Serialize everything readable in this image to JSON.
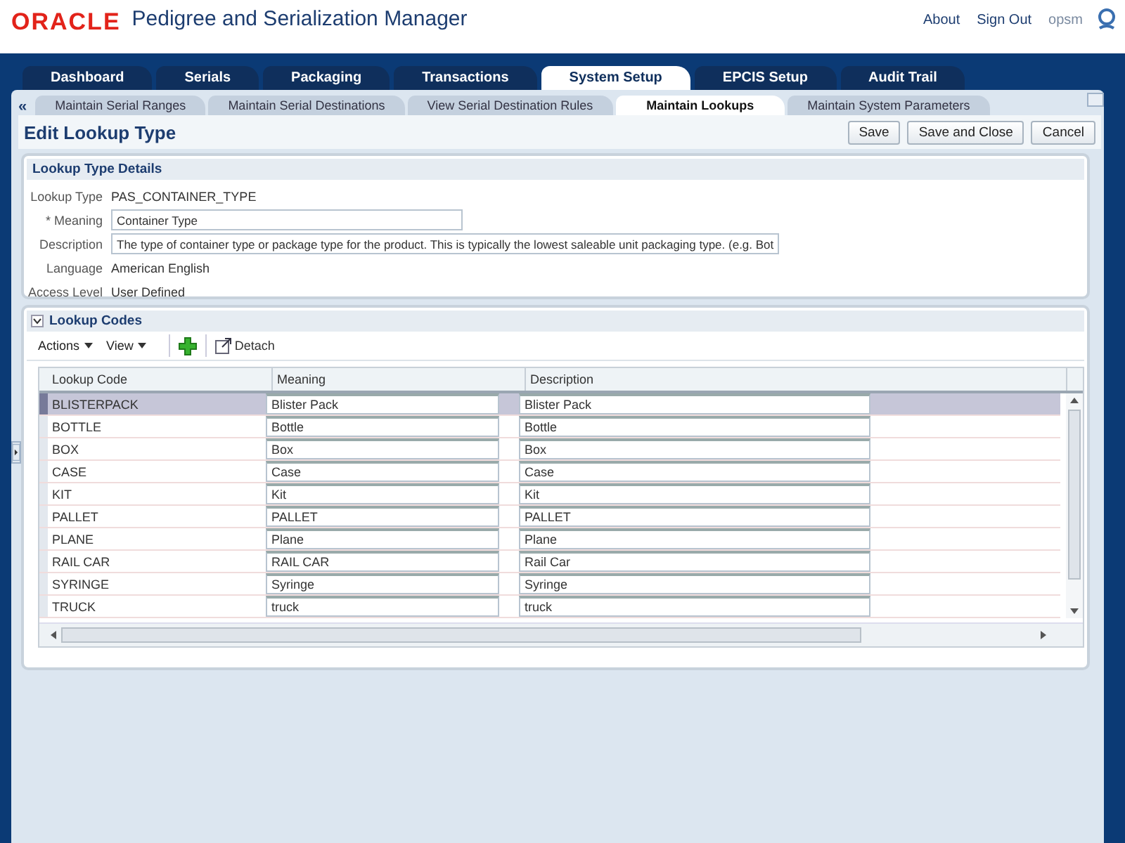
{
  "header": {
    "logo": "ORACLE",
    "title": "Pedigree and Serialization Manager",
    "links": [
      "About",
      "Sign Out"
    ],
    "user": "opsm"
  },
  "tabs": [
    {
      "label": "Dashboard",
      "selected": false
    },
    {
      "label": "Serials",
      "selected": false
    },
    {
      "label": "Packaging",
      "selected": false
    },
    {
      "label": "Transactions",
      "selected": false
    },
    {
      "label": "System Setup",
      "selected": true
    },
    {
      "label": "EPCIS Setup",
      "selected": false
    },
    {
      "label": "Audit Trail",
      "selected": false
    }
  ],
  "subtabs": {
    "scroll": "«",
    "items": [
      {
        "label": "Maintain Serial Ranges",
        "selected": false
      },
      {
        "label": "Maintain Serial Destinations",
        "selected": false
      },
      {
        "label": "View Serial Destination Rules",
        "selected": false
      },
      {
        "label": "Maintain Lookups",
        "selected": true
      },
      {
        "label": "Maintain System Parameters",
        "selected": false
      }
    ]
  },
  "page": {
    "title": "Edit Lookup Type",
    "buttons": [
      "Save",
      "Save and Close",
      "Cancel"
    ]
  },
  "details": {
    "title": "Lookup Type Details",
    "fields": [
      {
        "kind": "text",
        "label": "Lookup Type",
        "value": "PAS_CONTAINER_TYPE"
      },
      {
        "kind": "input",
        "label": "* Meaning",
        "value": "Container Type"
      },
      {
        "kind": "wide-input",
        "label": "Description",
        "value": "The type of container type or package type for the product.  This is typically the lowest saleable unit packaging type.  (e.g. Bot"
      },
      {
        "kind": "text",
        "label": "Language",
        "value": "American English"
      },
      {
        "kind": "text",
        "label": "Access Level",
        "value": "User Defined"
      }
    ]
  },
  "lookup_codes": {
    "title": "Lookup Codes",
    "menus": [
      "Actions",
      "View"
    ],
    "detach": "Detach",
    "columns": [
      "Lookup Code",
      "Meaning",
      "Description"
    ],
    "rows": [
      {
        "code": "BLISTERPACK",
        "meaning": "Blister Pack",
        "description": "Blister Pack",
        "selected": true
      },
      {
        "code": "BOTTLE",
        "meaning": "Bottle",
        "description": "Bottle",
        "selected": false
      },
      {
        "code": "BOX",
        "meaning": "Box",
        "description": "Box",
        "selected": false
      },
      {
        "code": "CASE",
        "meaning": "Case",
        "description": "Case",
        "selected": false
      },
      {
        "code": "KIT",
        "meaning": "Kit",
        "description": "Kit",
        "selected": false
      },
      {
        "code": "PALLET",
        "meaning": "PALLET",
        "description": "PALLET",
        "selected": false
      },
      {
        "code": "PLANE",
        "meaning": "Plane",
        "description": "Plane",
        "selected": false
      },
      {
        "code": "RAIL CAR",
        "meaning": "RAIL CAR",
        "description": "Rail Car",
        "selected": false
      },
      {
        "code": "SYRINGE",
        "meaning": "Syringe",
        "description": "Syringe",
        "selected": false
      },
      {
        "code": "TRUCK",
        "meaning": "truck",
        "description": "truck",
        "selected": false
      }
    ]
  }
}
